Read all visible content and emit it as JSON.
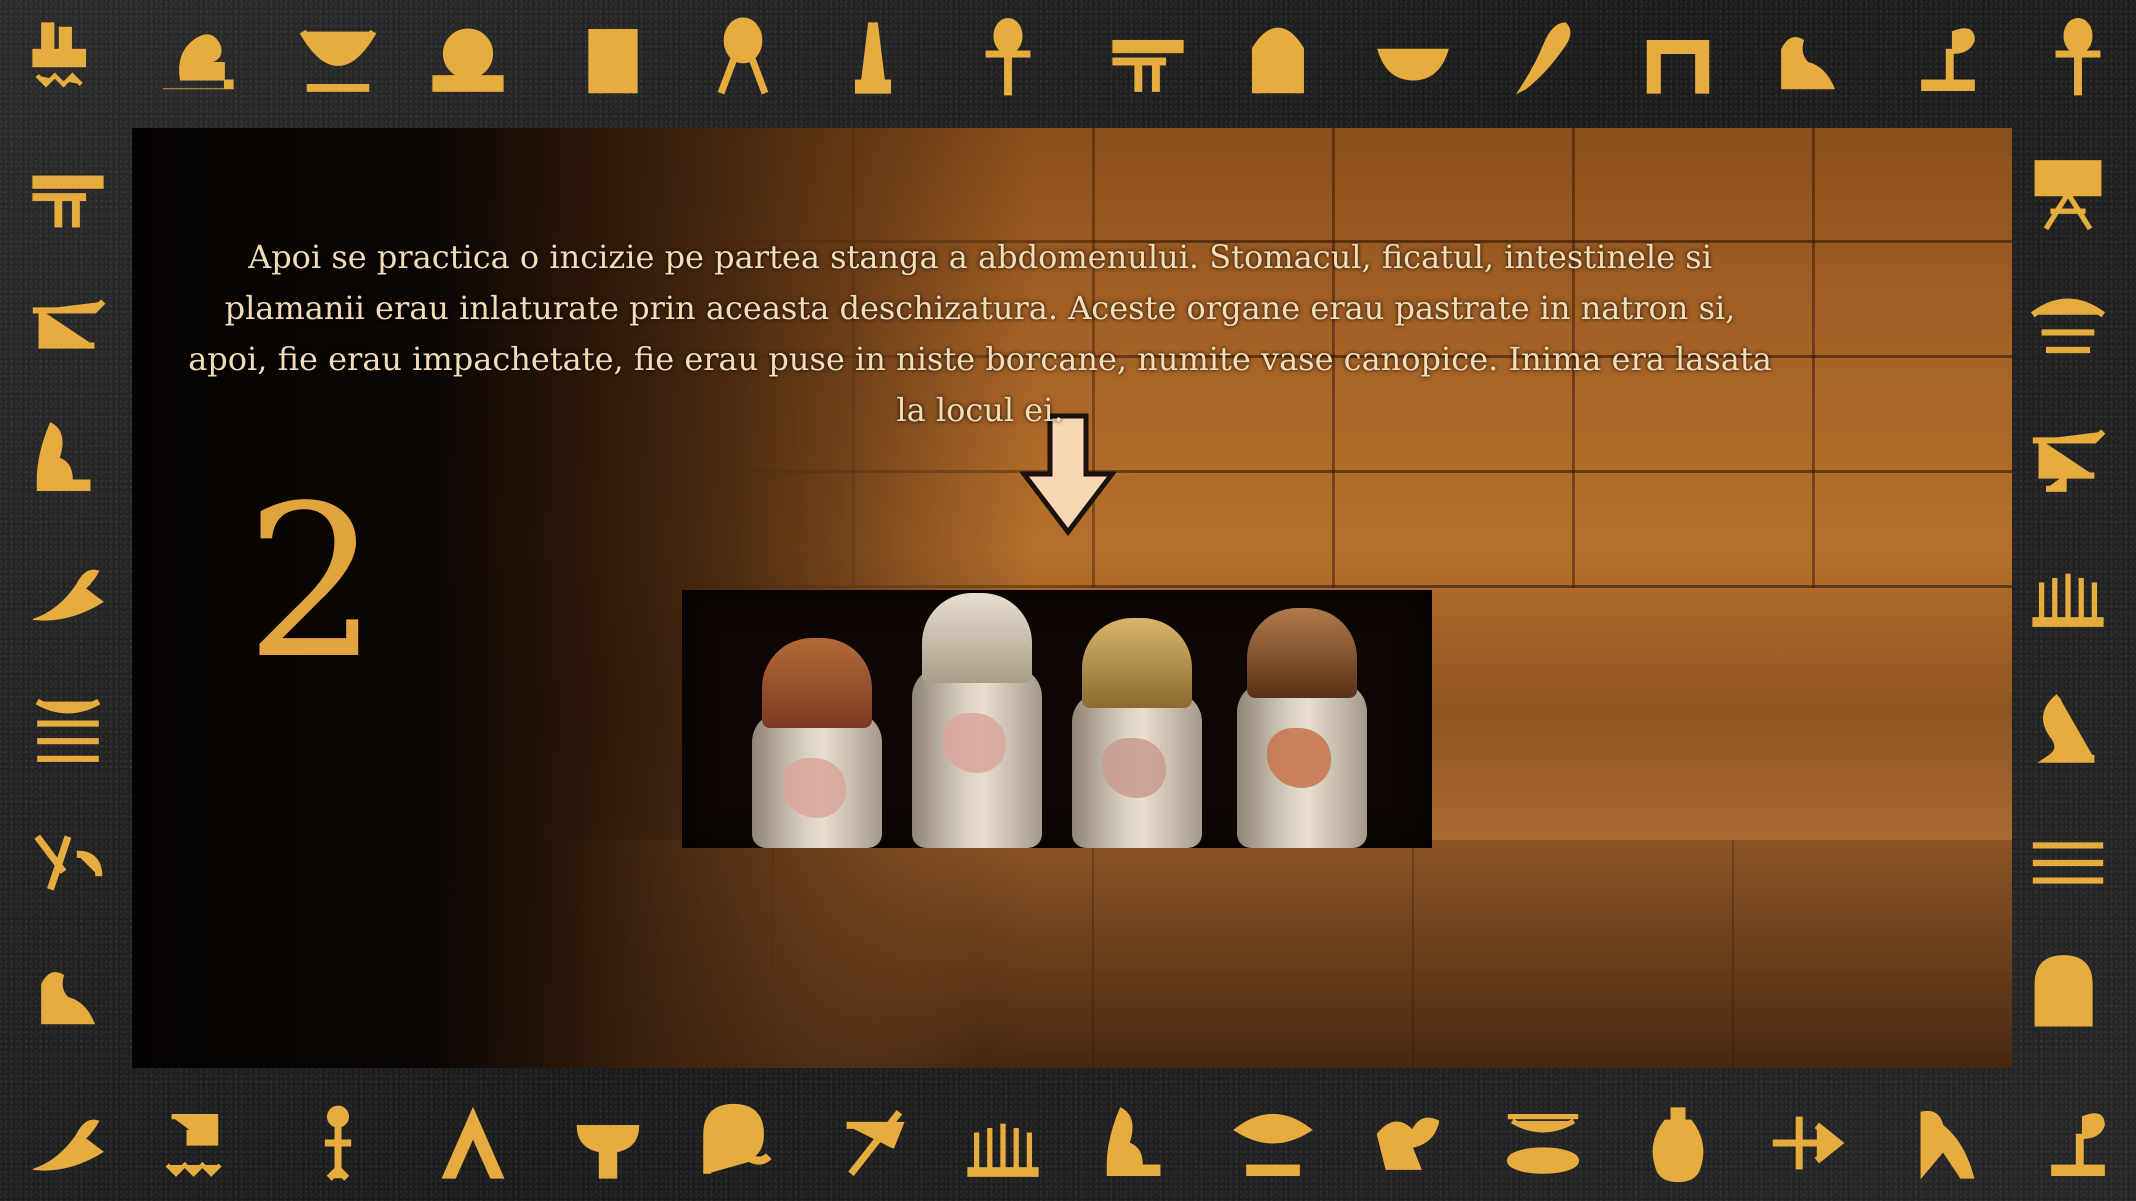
{
  "slide": {
    "caption": "Apoi se practica o incizie pe partea stanga a abdomenului. Stomacul, ficatul, intestinele si plamanii erau inlaturate prin aceasta deschizatura. Aceste organe erau pastrate in natron si, apoi, fie erau impachetate, fie erau puse in niste borcane, numite vase canopice. Inima era lasata la locul ei.",
    "step_number": "2"
  },
  "colors": {
    "hieroglyph_gold": "#e6ac3e",
    "caption_text": "#f3dcb8",
    "number_gold": "#e2a43c",
    "arrow_fill": "#f9d6b4"
  },
  "illustration": {
    "subject": "four canopic jars in a stone wall niche",
    "arrow_icon": "down-arrow-icon"
  }
}
